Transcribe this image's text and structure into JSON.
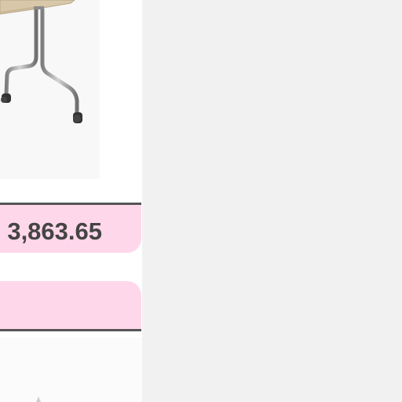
{
  "product": {
    "image_icon": "table-with-metal-legs-and-casters",
    "price": "3,863.65"
  },
  "colors": {
    "price_panel_bg": "#ffd7ea",
    "price_text": "#444444",
    "right_background": "#f1f1f1"
  }
}
